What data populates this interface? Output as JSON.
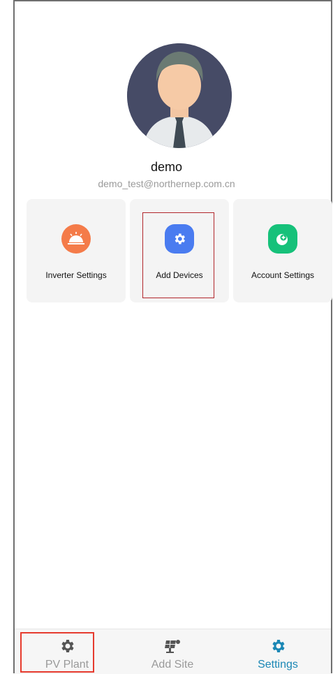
{
  "profile": {
    "username": "demo",
    "email": "demo_test@northernep.com.cn"
  },
  "cards": [
    {
      "label": "Inverter Settings",
      "icon": "sunrise-icon",
      "color": "#f47b49"
    },
    {
      "label": "Add Devices",
      "icon": "gear-icon",
      "color": "#4a7cf0"
    },
    {
      "label": "Account Settings",
      "icon": "account-icon",
      "color": "#16c17a"
    }
  ],
  "tabs": [
    {
      "label": "PV Plant",
      "icon": "gear-icon",
      "color": "#9a9a9a"
    },
    {
      "label": "Add Site",
      "icon": "solar-panel-icon",
      "color": "#9a9a9a"
    },
    {
      "label": "Settings",
      "icon": "gear-icon",
      "color": "#1a87b5",
      "active": true
    }
  ]
}
